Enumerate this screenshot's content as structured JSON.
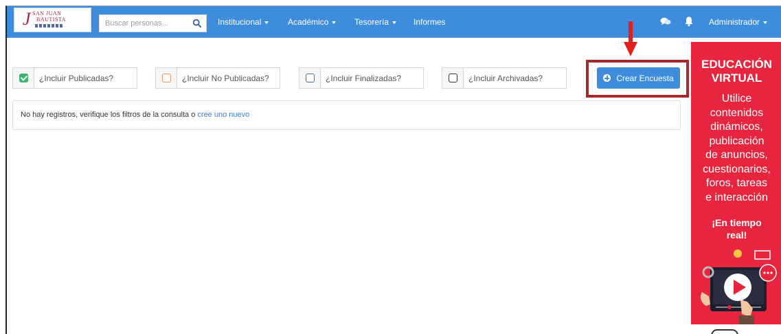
{
  "app": {
    "logo_text_1": "SAN JUAN",
    "logo_text_2": "BAUTISTA"
  },
  "navbar": {
    "search_placeholder": "Buscar personas...",
    "menu": [
      {
        "label": "Institucional",
        "dropdown": true
      },
      {
        "label": "Académico",
        "dropdown": true
      },
      {
        "label": "Tesorería",
        "dropdown": true
      },
      {
        "label": "Informes",
        "dropdown": false
      }
    ],
    "user_label": "Administrador",
    "icons": [
      "search-icon",
      "chat-icon",
      "bell-icon"
    ]
  },
  "filters": [
    {
      "label": "¿Incluir Publicadas?",
      "checked": true,
      "color": "#3fb06a"
    },
    {
      "label": "¿Incluir No Publicadas?",
      "checked": false,
      "color": "#e5965c"
    },
    {
      "label": "¿Incluir Finalizadas?",
      "checked": false,
      "color": "#4d6f9a"
    },
    {
      "label": "¿Incluir Archivadas?",
      "checked": false,
      "color": "#333333"
    }
  ],
  "actions": {
    "create_label": "Crear Encuesta"
  },
  "notice": {
    "text": "No hay registros, verifique los filtros de la consulta o ",
    "link": "cree uno nuevo"
  },
  "ad": {
    "title_1": "EDUCACIÓN",
    "title_2": "VIRTUAL",
    "body": [
      "Utilice",
      "contenidos",
      "dinámicos,",
      "publicación",
      "de anuncios,",
      "cuestionarios,",
      "foros, tareas",
      "e interacción"
    ],
    "realtime_1": "¡En tiempo",
    "realtime_2": "real!"
  },
  "colors": {
    "navbar": "#3e8ddd",
    "accent_button": "#3e8ddd",
    "ad_background": "#e8253e",
    "highlight_border": "#a72a2a",
    "arrow": "#e0201c"
  }
}
